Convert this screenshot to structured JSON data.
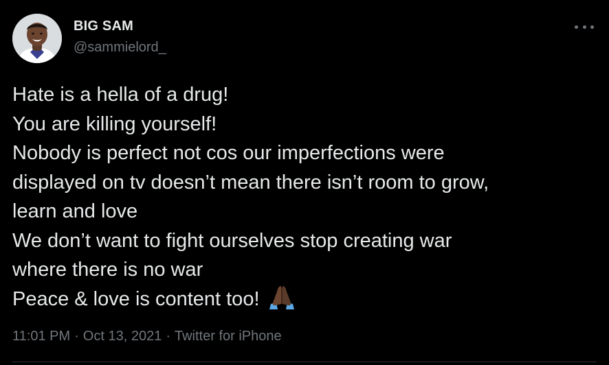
{
  "author": {
    "display_name": "BIG SAM",
    "handle": "@sammielord_",
    "avatar_icon": "profile-photo"
  },
  "tweet": {
    "lines": [
      "Hate is a hella of a drug!",
      "You are killing yourself!",
      "Nobody is perfect not cos our imperfections were",
      "displayed on tv doesn’t mean there isn’t room to grow,",
      "learn and love",
      "We don’t want to fight ourselves stop creating war",
      "where there is no war",
      "Peace & love is content too!"
    ],
    "emoji": "folded-hands-dark-skin-tone"
  },
  "meta": {
    "time": "11:01 PM",
    "date": "Oct 13, 2021",
    "source": "Twitter for iPhone",
    "separator": "·"
  },
  "more_icon": "more-horizontal-icon",
  "colors": {
    "background": "#000000",
    "text": "#e7e9ea",
    "secondary": "#71767b"
  }
}
